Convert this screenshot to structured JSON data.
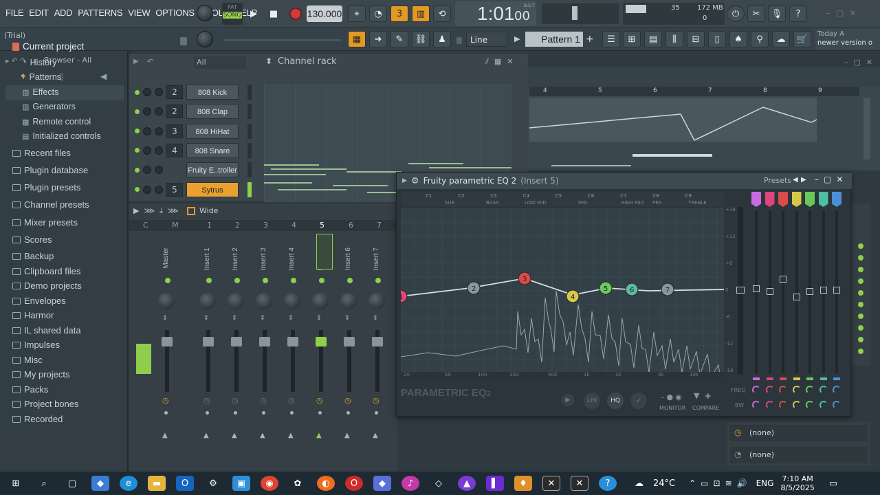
{
  "menu": [
    "FILE",
    "EDIT",
    "ADD",
    "PATTERNS",
    "VIEW",
    "OPTIONS",
    "TOOLS",
    "HELP"
  ],
  "hint": "(Trial)",
  "transport": {
    "mode_top": "PAT",
    "mode_bottom": "SONG",
    "tempo": "130.000",
    "time": "1:01",
    "time_sub": "00",
    "time_label": "B:S:T",
    "counter1": "35",
    "memory": "172 MB",
    "counter2": "0"
  },
  "snap": "Line",
  "pattern": "Pattern 1",
  "news": {
    "line1": "Today  A",
    "line2": "newer version o"
  },
  "browser": {
    "title": "Browser - All",
    "items": [
      {
        "label": "Current project",
        "type": "head"
      },
      {
        "label": "History",
        "type": "sub"
      },
      {
        "label": "Patterns",
        "type": "sub"
      },
      {
        "label": "Effects",
        "type": "sub"
      },
      {
        "label": "Generators",
        "type": "sub"
      },
      {
        "label": "Remote control",
        "type": "sub"
      },
      {
        "label": "Initialized controls",
        "type": "sub"
      },
      {
        "label": "Recent files",
        "type": "item"
      },
      {
        "label": "Plugin database",
        "type": "item"
      },
      {
        "label": "Plugin presets",
        "type": "item"
      },
      {
        "label": "Channel presets",
        "type": "item"
      },
      {
        "label": "Mixer presets",
        "type": "item"
      },
      {
        "label": "Scores",
        "type": "item"
      },
      {
        "label": "Backup",
        "type": "item"
      },
      {
        "label": "Clipboard files",
        "type": "item"
      },
      {
        "label": "Demo projects",
        "type": "item"
      },
      {
        "label": "Envelopes",
        "type": "item"
      },
      {
        "label": "Harmor",
        "type": "item"
      },
      {
        "label": "IL shared data",
        "type": "item"
      },
      {
        "label": "Impulses",
        "type": "item"
      },
      {
        "label": "Misc",
        "type": "item"
      },
      {
        "label": "My projects",
        "type": "item"
      },
      {
        "label": "Packs",
        "type": "item"
      },
      {
        "label": "Project bones",
        "type": "item"
      },
      {
        "label": "Recorded",
        "type": "item"
      }
    ]
  },
  "rack": {
    "filter": "All",
    "title": "Channel rack",
    "channels": [
      {
        "num": "2",
        "name": "808 Kick"
      },
      {
        "num": "2",
        "name": "808 Clap"
      },
      {
        "num": "3",
        "name": "808 HiHat"
      },
      {
        "num": "4",
        "name": "808 Snare"
      },
      {
        "num": "",
        "name": "Fruity E..troller"
      },
      {
        "num": "5",
        "name": "Sytrus"
      }
    ]
  },
  "mixer": {
    "view": "Wide",
    "cols": [
      "C",
      "M",
      "1",
      "2",
      "3",
      "4",
      "5",
      "6",
      "7"
    ],
    "strips": [
      "Master",
      "Insert 1",
      "Insert 2",
      "Insert 3",
      "Insert 4",
      "Insert 5",
      "Insert 6",
      "Insert 7"
    ]
  },
  "eq": {
    "title": "Fruity parametric EQ 2",
    "insert": "(Insert 5)",
    "presets": "Presets",
    "band_heads": [
      "C1",
      "C2",
      "C3",
      "C4",
      "C5",
      "C6",
      "C7",
      "C8",
      "C9"
    ],
    "regions": [
      "SUB",
      "BASS",
      "LOW MID",
      "MID",
      "HIGH MID",
      "PRS",
      "TREBLE"
    ],
    "db_labels": [
      "+18",
      "+12",
      "+6",
      "0",
      "-6",
      "-12",
      "-18"
    ],
    "freq_labels": [
      "20",
      "50",
      "100",
      "200",
      "500",
      "1k",
      "2k",
      "5k",
      "10k"
    ],
    "logo": "PARAMETRIC EQ",
    "logo_sub": "2",
    "buttons": {
      "lin": "LIN",
      "hq": "HQ",
      "monitor": "MONITOR",
      "compare": "COMPARE"
    },
    "side_labels": {
      "freq": "FREQ",
      "bw": "BW"
    },
    "bands": [
      {
        "n": "1",
        "color": "#e0457a"
      },
      {
        "n": "2",
        "color": "#8a969c"
      },
      {
        "n": "3",
        "color": "#d94a4a"
      },
      {
        "n": "4",
        "color": "#d7c64a"
      },
      {
        "n": "5",
        "color": "#6ac85a"
      },
      {
        "n": "6",
        "color": "#5fb8a0"
      },
      {
        "n": "7",
        "color": "#8a969c"
      }
    ]
  },
  "playlist": {
    "ruler": [
      "4",
      "5",
      "6",
      "7",
      "8",
      "9"
    ]
  },
  "routing": [
    "(none)",
    "(none)"
  ],
  "taskbar": {
    "weather": "24°C",
    "lang": "ENG",
    "time": "7:10 AM",
    "date": "8/5/2025"
  }
}
